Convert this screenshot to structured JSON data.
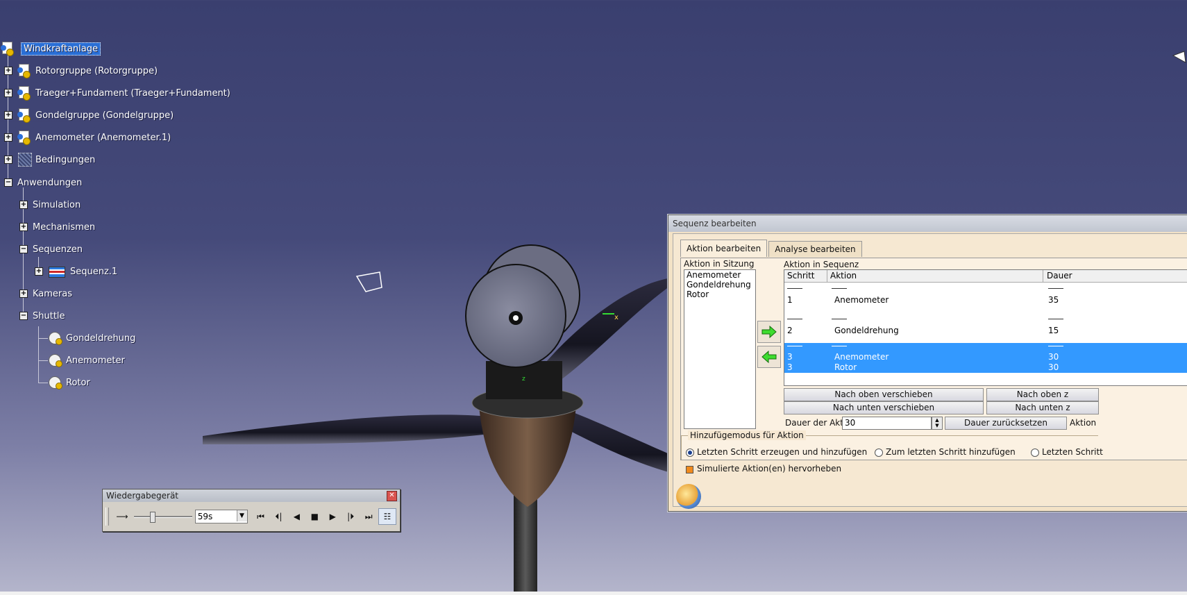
{
  "tree": {
    "root": "Windkraftanlage",
    "items": [
      {
        "label": "Rotorgruppe (Rotorgruppe)"
      },
      {
        "label": "Traeger+Fundament (Traeger+Fundament)"
      },
      {
        "label": "Gondelgruppe (Gondelgruppe)"
      },
      {
        "label": "Anemometer (Anemometer.1)"
      },
      {
        "label": "Bedingungen"
      },
      {
        "label": "Anwendungen"
      },
      {
        "label": "Simulation"
      },
      {
        "label": "Mechanismen"
      },
      {
        "label": "Sequenzen"
      },
      {
        "label": "Sequenz.1"
      },
      {
        "label": "Kameras"
      },
      {
        "label": "Shuttle"
      },
      {
        "label": "Gondeldrehung"
      },
      {
        "label": "Anemometer"
      },
      {
        "label": "Rotor"
      }
    ]
  },
  "player": {
    "title": "Wiedergabegerät",
    "time_value": "59s",
    "slider_fraction": 0.3,
    "buttons": [
      "skip-back",
      "step-back",
      "play-reverse",
      "stop",
      "play",
      "step-forward",
      "skip-forward",
      "settings"
    ]
  },
  "dialog": {
    "title": "Sequenz bearbeiten",
    "tabs": [
      "Aktion bearbeiten",
      "Analyse bearbeiten"
    ],
    "session_label": "Aktion in Sitzung",
    "session_items": [
      "Anemometer",
      "Gondeldrehung",
      "Rotor"
    ],
    "sequence_label": "Aktion in Sequenz",
    "columns": [
      "Schritt",
      "Aktion",
      "Dauer"
    ],
    "rows": [
      {
        "step": "1",
        "action": "Anemometer",
        "duration": "35",
        "selected": false
      },
      {
        "step": "2",
        "action": "Gondeldrehung",
        "duration": "15",
        "selected": false
      },
      {
        "step": "3",
        "action": "Anemometer",
        "duration": "30",
        "selected": true
      },
      {
        "step": "3",
        "action": "Rotor",
        "duration": "30",
        "selected": true
      }
    ],
    "btn_up": "Nach oben verschieben",
    "btn_down": "Nach unten verschieben",
    "btn_up_right": "Nach oben z",
    "btn_down_right": "Nach unten z",
    "duration_label": "Dauer der Aktion",
    "duration_value": "30",
    "btn_reset": "Dauer zurücksetzen",
    "action_trunc": "Aktion",
    "mode_title": "Hinzufügemodus für Aktion",
    "mode_options": [
      "Letzten Schritt erzeugen und hinzufügen",
      "Zum letzten Schritt hinzufügen",
      "Letzten Schritt"
    ],
    "mode_selected": 0,
    "highlight_label": "Simulierte Aktion(en) hervorheben"
  },
  "colors": {
    "bg_top": "#3a3f6f",
    "bg_bottom": "#b5b6cc",
    "selection": "#3399ff",
    "dialog_bg": "#f3e2c6"
  }
}
